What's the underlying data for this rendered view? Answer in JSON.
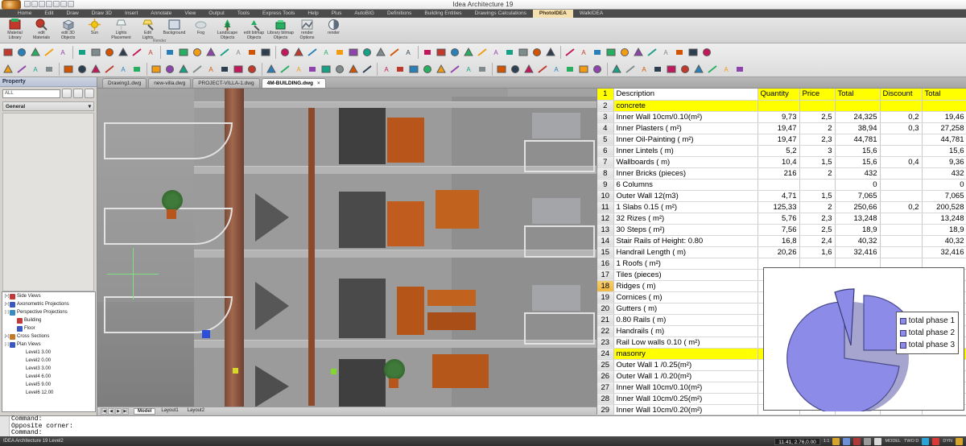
{
  "window": {
    "title": "Idea Architecture 19"
  },
  "ribbon_tabs": [
    {
      "label": "Home",
      "active": false
    },
    {
      "label": "Edit",
      "active": false
    },
    {
      "label": "Draw",
      "active": false
    },
    {
      "label": "Draw 3D",
      "active": false
    },
    {
      "label": "Insert",
      "active": false
    },
    {
      "label": "Annotate",
      "active": false
    },
    {
      "label": "View",
      "active": false
    },
    {
      "label": "Output",
      "active": false
    },
    {
      "label": "Tools",
      "active": false
    },
    {
      "label": "Express Tools",
      "active": false
    },
    {
      "label": "Help",
      "active": false
    },
    {
      "label": "Plus",
      "active": false
    },
    {
      "label": "AutoBIG",
      "active": false
    },
    {
      "label": "Definitions",
      "active": false
    },
    {
      "label": "Building Entities",
      "active": false
    },
    {
      "label": "Drawings Calculations",
      "active": false
    },
    {
      "label": "PhotoIDEA",
      "active": true
    },
    {
      "label": "WalkIDEA",
      "active": false
    }
  ],
  "ribbon": {
    "group_name": "Render",
    "items": [
      {
        "line1": "Material",
        "line2": "Library",
        "icon": "material-library-icon"
      },
      {
        "line1": "edit",
        "line2": "Materials",
        "icon": "edit-materials-icon"
      },
      {
        "line1": "edit 3D",
        "line2": "Objects",
        "icon": "edit-3d-objects-icon"
      },
      {
        "line1": "Sun",
        "line2": "",
        "icon": "sun-icon"
      },
      {
        "line1": "Lights",
        "line2": "Placement",
        "icon": "lights-placement-icon"
      },
      {
        "line1": "Edit",
        "line2": "Lights",
        "icon": "edit-lights-icon"
      },
      {
        "line1": "Background",
        "line2": "",
        "icon": "background-icon"
      },
      {
        "line1": "Fog",
        "line2": "",
        "icon": "fog-icon"
      },
      {
        "line1": "Landscape",
        "line2": "Objects",
        "icon": "landscape-objects-icon"
      },
      {
        "line1": "edit bitmap",
        "line2": "Objects",
        "icon": "edit-bitmap-objects-icon"
      },
      {
        "line1": "Library bitmap",
        "line2": "Objects",
        "icon": "library-bitmap-objects-icon"
      },
      {
        "line1": "render",
        "line2": "Options",
        "icon": "render-options-icon"
      },
      {
        "line1": "render",
        "line2": "",
        "icon": "render-icon"
      }
    ]
  },
  "property_panel": {
    "title": "Property",
    "selection_value": "ALL",
    "section_label": "General",
    "section_chevron": "▾",
    "buttons": [
      "quick-select-icon",
      "refresh-icon",
      "filter-icon"
    ]
  },
  "tree": {
    "nodes": [
      {
        "level": 1,
        "label": "Side Views",
        "expander": "[+]",
        "color": "#c03a3a"
      },
      {
        "level": 1,
        "label": "Axonometric Projections",
        "expander": "[+]",
        "color": "#3a58c0"
      },
      {
        "level": 1,
        "label": "Perspective Projections",
        "expander": "[-]",
        "color": "#3a8ac0"
      },
      {
        "level": 2,
        "label": "Building",
        "expander": "",
        "color": "#c03a3a"
      },
      {
        "level": 2,
        "label": "Floor",
        "expander": "",
        "color": "#3a58c0"
      },
      {
        "level": 1,
        "label": "Cross Sections",
        "expander": "[+]",
        "color": "#c07a2a"
      },
      {
        "level": 1,
        "label": "Plan Views",
        "expander": "[-]",
        "color": "#3a58c0"
      },
      {
        "level": 3,
        "label": "Level1   3.00",
        "expander": "",
        "color": ""
      },
      {
        "level": 3,
        "label": "Level2   0.00",
        "expander": "",
        "color": ""
      },
      {
        "level": 3,
        "label": "Level3   3.00",
        "expander": "",
        "color": ""
      },
      {
        "level": 3,
        "label": "Level4   6.00",
        "expander": "",
        "color": ""
      },
      {
        "level": 3,
        "label": "Level5   9.00",
        "expander": "",
        "color": ""
      },
      {
        "level": 3,
        "label": "Level6   12.00",
        "expander": "",
        "color": ""
      }
    ]
  },
  "document_tabs": [
    {
      "label": "Drawing1.dwg",
      "active": false
    },
    {
      "label": "new-villa.dwg",
      "active": false
    },
    {
      "label": "PROJECT-VILLA-1.dwg",
      "active": false
    },
    {
      "label": "4M-BUILDING.dwg",
      "active": true,
      "close": "×"
    }
  ],
  "viewport_tabs": [
    {
      "label": "Model",
      "active": true
    },
    {
      "label": "Layout1",
      "active": false
    },
    {
      "label": "Layout2",
      "active": false
    }
  ],
  "sheet": {
    "columns": [
      "Description",
      "Quantity",
      "Price",
      "Total",
      "Discount",
      "Total"
    ],
    "rows": [
      {
        "n": "1",
        "type": "header",
        "desc": "Description",
        "q": "Quantity",
        "p": "Price",
        "t": "Total",
        "d": "Discount",
        "t2": "Total"
      },
      {
        "n": "2",
        "type": "category",
        "desc": "concrete",
        "q": "",
        "p": "",
        "t": "",
        "d": "",
        "t2": ""
      },
      {
        "n": "3",
        "type": "data",
        "desc": "Inner Wall 10cm/0.10(m²)",
        "q": "9,73",
        "p": "2,5",
        "t": "24,325",
        "d": "0,2",
        "t2": "19,46"
      },
      {
        "n": "4",
        "type": "data",
        "desc": "Inner Plasters ( m²)",
        "q": "19,47",
        "p": "2",
        "t": "38,94",
        "d": "0,3",
        "t2": "27,258"
      },
      {
        "n": "5",
        "type": "data",
        "desc": "Inner Oil-Painting ( m²)",
        "q": "19,47",
        "p": "2,3",
        "t": "44,781",
        "d": "",
        "t2": "44,781"
      },
      {
        "n": "6",
        "type": "data",
        "desc": "Inner Lintels ( m)",
        "q": "5,2",
        "p": "3",
        "t": "15,6",
        "d": "",
        "t2": "15,6"
      },
      {
        "n": "7",
        "type": "data",
        "desc": "Wallboards ( m)",
        "q": "10,4",
        "p": "1,5",
        "t": "15,6",
        "d": "0,4",
        "t2": "9,36"
      },
      {
        "n": "8",
        "type": "data",
        "desc": "Inner Bricks (pieces)",
        "q": "216",
        "p": "2",
        "t": "432",
        "d": "",
        "t2": "432"
      },
      {
        "n": "9",
        "type": "data",
        "desc": "6 Columns",
        "q": "",
        "p": "",
        "t": "0",
        "d": "",
        "t2": "0"
      },
      {
        "n": "10",
        "type": "data",
        "desc": "Outer Wall 12(m3)",
        "q": "4,71",
        "p": "1,5",
        "t": "7,065",
        "d": "",
        "t2": "7,065"
      },
      {
        "n": "11",
        "type": "data",
        "desc": "1 Slabs 0.15 ( m²)",
        "q": "125,33",
        "p": "2",
        "t": "250,66",
        "d": "0,2",
        "t2": "200,528"
      },
      {
        "n": "12",
        "type": "data",
        "desc": "32 Rizes ( m²)",
        "q": "5,76",
        "p": "2,3",
        "t": "13,248",
        "d": "",
        "t2": "13,248"
      },
      {
        "n": "13",
        "type": "data",
        "desc": "30 Steps ( m²)",
        "q": "7,56",
        "p": "2,5",
        "t": "18,9",
        "d": "",
        "t2": "18,9"
      },
      {
        "n": "14",
        "type": "data",
        "desc": "Stair Rails of Height: 0.80",
        "q": "16,8",
        "p": "2,4",
        "t": "40,32",
        "d": "",
        "t2": "40,32"
      },
      {
        "n": "15",
        "type": "data",
        "desc": "Handrail Length ( m)",
        "q": "20,26",
        "p": "1,6",
        "t": "32,416",
        "d": "",
        "t2": "32,416"
      },
      {
        "n": "16",
        "type": "data",
        "desc": "1 Roofs ( m²)",
        "q": "",
        "p": "",
        "t": "",
        "d": "",
        "t2": ""
      },
      {
        "n": "17",
        "type": "data",
        "desc": "Tiles (pieces)",
        "q": "",
        "p": "",
        "t": "",
        "d": "",
        "t2": ""
      },
      {
        "n": "18",
        "type": "selected",
        "desc": "Ridges ( m)",
        "q": "",
        "p": "",
        "t": "",
        "d": "",
        "t2": ""
      },
      {
        "n": "19",
        "type": "data",
        "desc": "Cornices ( m)",
        "q": "",
        "p": "",
        "t": "",
        "d": "",
        "t2": ""
      },
      {
        "n": "20",
        "type": "data",
        "desc": "Gutters ( m)",
        "q": "",
        "p": "",
        "t": "",
        "d": "",
        "t2": ""
      },
      {
        "n": "21",
        "type": "data",
        "desc": "0.80 Rails ( m)",
        "q": "",
        "p": "",
        "t": "",
        "d": "",
        "t2": ""
      },
      {
        "n": "22",
        "type": "data",
        "desc": "Handrails ( m)",
        "q": "",
        "p": "",
        "t": "",
        "d": "",
        "t2": ""
      },
      {
        "n": "23",
        "type": "data",
        "desc": "Rail Low walls 0.10 ( m²)",
        "q": "",
        "p": "",
        "t": "",
        "d": "",
        "t2": ""
      },
      {
        "n": "24",
        "type": "category",
        "desc": "masonry",
        "q": "",
        "p": "",
        "t": "",
        "d": "",
        "t2": ""
      },
      {
        "n": "25",
        "type": "data",
        "desc": "Outer Wall 1 /0.25(m²)",
        "q": "",
        "p": "",
        "t": "",
        "d": "",
        "t2": ""
      },
      {
        "n": "26",
        "type": "data",
        "desc": "Outer Wall 1 /0.20(m²)",
        "q": "",
        "p": "",
        "t": "",
        "d": "",
        "t2": ""
      },
      {
        "n": "27",
        "type": "data",
        "desc": "Inner Wall 10cm/0.10(m²)",
        "q": "",
        "p": "",
        "t": "",
        "d": "",
        "t2": ""
      },
      {
        "n": "28",
        "type": "data",
        "desc": "Inner Wall 10cm/0.25(m²)",
        "q": "",
        "p": "",
        "t": "",
        "d": "",
        "t2": ""
      },
      {
        "n": "29",
        "type": "data",
        "desc": "Inner Wall 10cm/0.20(m²)",
        "q": "",
        "p": "",
        "t": "",
        "d": "",
        "t2": ""
      }
    ]
  },
  "chart_data": {
    "type": "pie",
    "title": "",
    "labels": [
      "total phase 1",
      "total phase 2",
      "total phase 3"
    ],
    "values": [
      22,
      11,
      67
    ],
    "colors": [
      "#8c8ce8",
      "#8c8ce8",
      "#8c8ce8"
    ],
    "exploded": true,
    "legend_position": "right"
  },
  "command_area": {
    "lines": [
      "Command:",
      "Opposite corner:",
      "Command:"
    ]
  },
  "statusbar": {
    "app_label": "IDEA Architecture 19 Level2",
    "coordinates": "11.41, 2.76,0.00",
    "scale": "1:1",
    "model_label": "MODEL",
    "twoddtwod_label": "TWO D",
    "dyn_label": "DYN"
  }
}
